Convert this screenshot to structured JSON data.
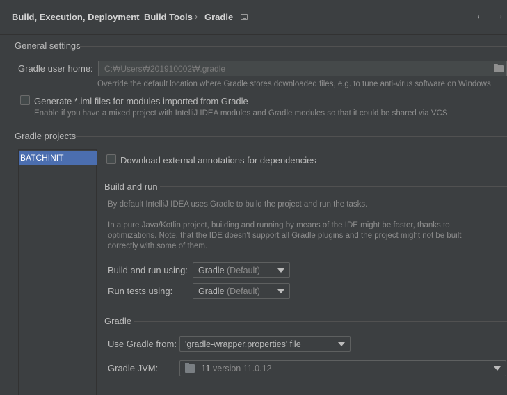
{
  "breadcrumb": {
    "items": [
      "Build, Execution, Deployment",
      "Build Tools",
      "Gradle"
    ],
    "separator": "›"
  },
  "nav": {
    "back": "←",
    "forward": "→"
  },
  "general": {
    "title": "General settings",
    "user_home_label": "Gradle user home:",
    "user_home_placeholder": "C:₩Users₩201910002₩.gradle",
    "user_home_hint": "Override the default location where Gradle stores downloaded files, e.g. to tune anti-virus software on Windows",
    "iml_label": "Generate *.iml files for modules imported from Gradle",
    "iml_hint": "Enable if you have a mixed project with IntelliJ IDEA modules and Gradle modules so that it could be shared via VCS",
    "iml_checked": false
  },
  "projects": {
    "title": "Gradle projects",
    "items": [
      "BATCHINIT"
    ],
    "download_annotations_label": "Download external annotations for dependencies",
    "download_annotations_checked": false
  },
  "build_and_run": {
    "title": "Build and run",
    "hint1": "By default IntelliJ IDEA uses Gradle to build the project and run the tasks.",
    "hint2": "In a pure Java/Kotlin project, building and running by means of the IDE might be faster, thanks to optimizations. Note, that the IDE doesn't support all Gradle plugins and the project might not be built correctly with some of them.",
    "build_using_label": "Build and run using:",
    "build_using_value": "Gradle",
    "build_using_suffix": "(Default)",
    "tests_using_label": "Run tests using:",
    "tests_using_value": "Gradle",
    "tests_using_suffix": "(Default)"
  },
  "gradle": {
    "title": "Gradle",
    "use_from_label": "Use Gradle from:",
    "use_from_value": "'gradle-wrapper.properties' file",
    "jvm_label": "Gradle JVM:",
    "jvm_value": "11",
    "jvm_version": "version 11.0.12"
  }
}
